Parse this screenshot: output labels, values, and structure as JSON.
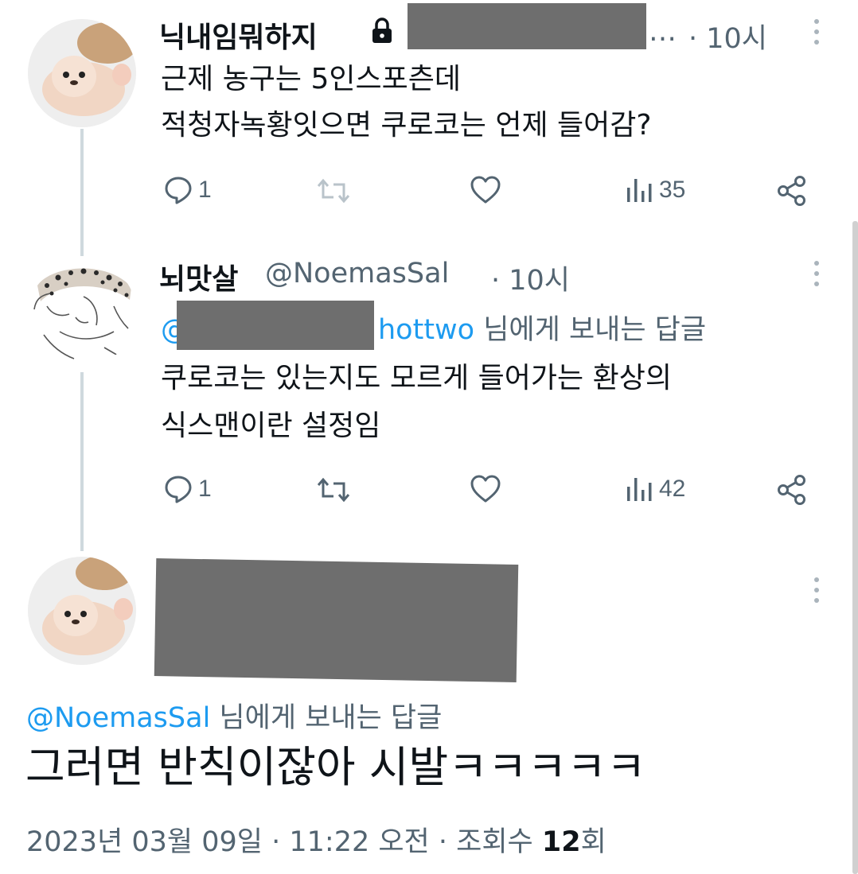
{
  "tweet1": {
    "display_name": "닉내임뭐하지",
    "handle_suffix": "…",
    "time": "· 10시",
    "lines": [
      "근제 농구는 5인스포츤데",
      "적청자녹황잇으면 쿠로코는 언제 들어감?"
    ],
    "actions": {
      "reply_count": "1",
      "retweet_count": "",
      "views": "35"
    }
  },
  "tweet2": {
    "display_name": "뇌맛살",
    "handle": "@NoemasSal",
    "time": "· 10시",
    "reply_to_prefix": "@",
    "reply_to_suffix": "hottwo",
    "reply_to_text": " 님에게 보내는 답글",
    "lines": [
      "쿠로코는 있는지도 모르게 들어가는 환상의",
      "식스맨이란 설정임"
    ],
    "actions": {
      "reply_count": "1",
      "retweet_count": "",
      "views": "42"
    }
  },
  "tweet3": {
    "reply_to_handle": "@NoemasSal",
    "reply_to_text": " 님에게 보내는 답글",
    "text": "그러면 반칙이잖아 시발ㅋㅋㅋㅋㅋ",
    "date": "2023년 03월 09일 · 11:22 오전 · 조회수 ",
    "views_count": "12",
    "views_suffix": "회"
  },
  "icons": {
    "lock": "lock-icon",
    "reply": "reply-icon",
    "retweet": "retweet-icon",
    "like": "heart-icon",
    "views": "views-icon",
    "share": "share-icon",
    "more": "more-icon"
  },
  "colors": {
    "link": "#1d9bf0",
    "muted": "#536471",
    "text": "#0f1419",
    "thread_line": "#cfd9de",
    "redaction": "#6e6e6e"
  }
}
